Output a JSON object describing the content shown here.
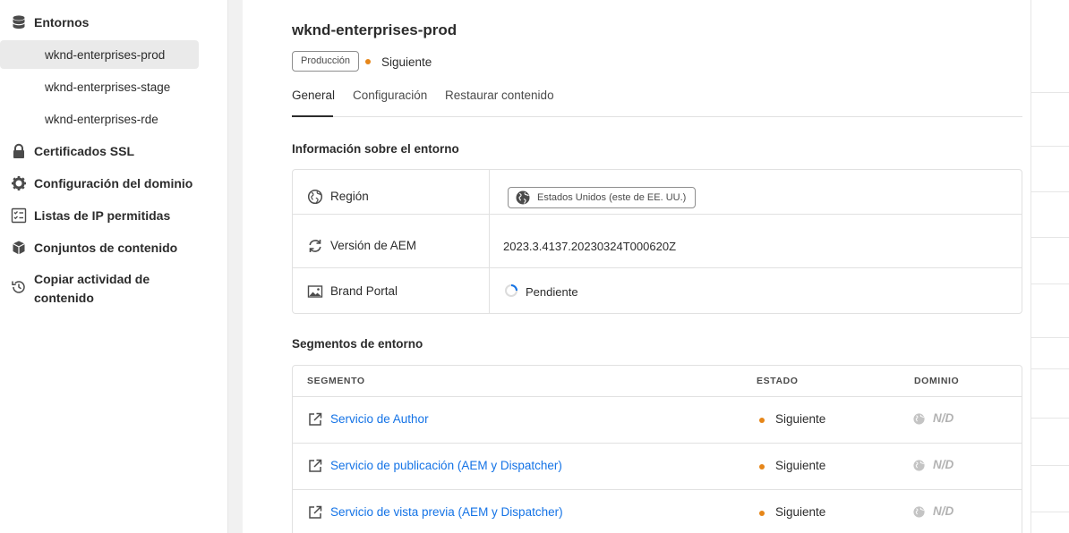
{
  "sidebar": {
    "environments": {
      "label": "Entornos",
      "items": [
        {
          "label": "wknd-enterprises-prod"
        },
        {
          "label": "wknd-enterprises-stage"
        },
        {
          "label": "wknd-enterprises-rde"
        }
      ]
    },
    "ssl": {
      "label": "Certificados SSL"
    },
    "domain": {
      "label": "Configuración del dominio"
    },
    "ip": {
      "label": "Listas de IP permitidas"
    },
    "content_sets": {
      "label": "Conjuntos de contenido"
    },
    "copy_activity": {
      "line1": "Copiar actividad de",
      "line2": "contenido"
    }
  },
  "env": {
    "title": "wknd-enterprises-prod",
    "tag": "Producción",
    "status": "Siguiente",
    "status_color": "#e68619"
  },
  "tabs": [
    {
      "label": "General"
    },
    {
      "label": "Configuración"
    },
    {
      "label": "Restaurar contenido"
    }
  ],
  "info": {
    "title": "Información sobre el entorno",
    "region": {
      "label": "Región",
      "value": "Estados Unidos (este de EE. UU.)"
    },
    "aem": {
      "label": "Versión de AEM",
      "value": "2023.3.4137.20230324T000620Z"
    },
    "brand": {
      "label": "Brand Portal",
      "value": "Pendiente"
    }
  },
  "segments": {
    "title": "Segmentos de entorno",
    "headers": {
      "segment": "SEGMENTO",
      "status": "ESTADO",
      "domain": "DOMINIO"
    },
    "rows": [
      {
        "name": "Servicio de Author",
        "status": "Siguiente",
        "domain": "N/D"
      },
      {
        "name": "Servicio de publicación (AEM y Dispatcher)",
        "status": "Siguiente",
        "domain": "N/D"
      },
      {
        "name": "Servicio de vista previa (AEM y Dispatcher)",
        "status": "Siguiente",
        "domain": "N/D"
      }
    ]
  },
  "colors": {
    "link": "#1473e6",
    "status_pending": "#e68619"
  }
}
